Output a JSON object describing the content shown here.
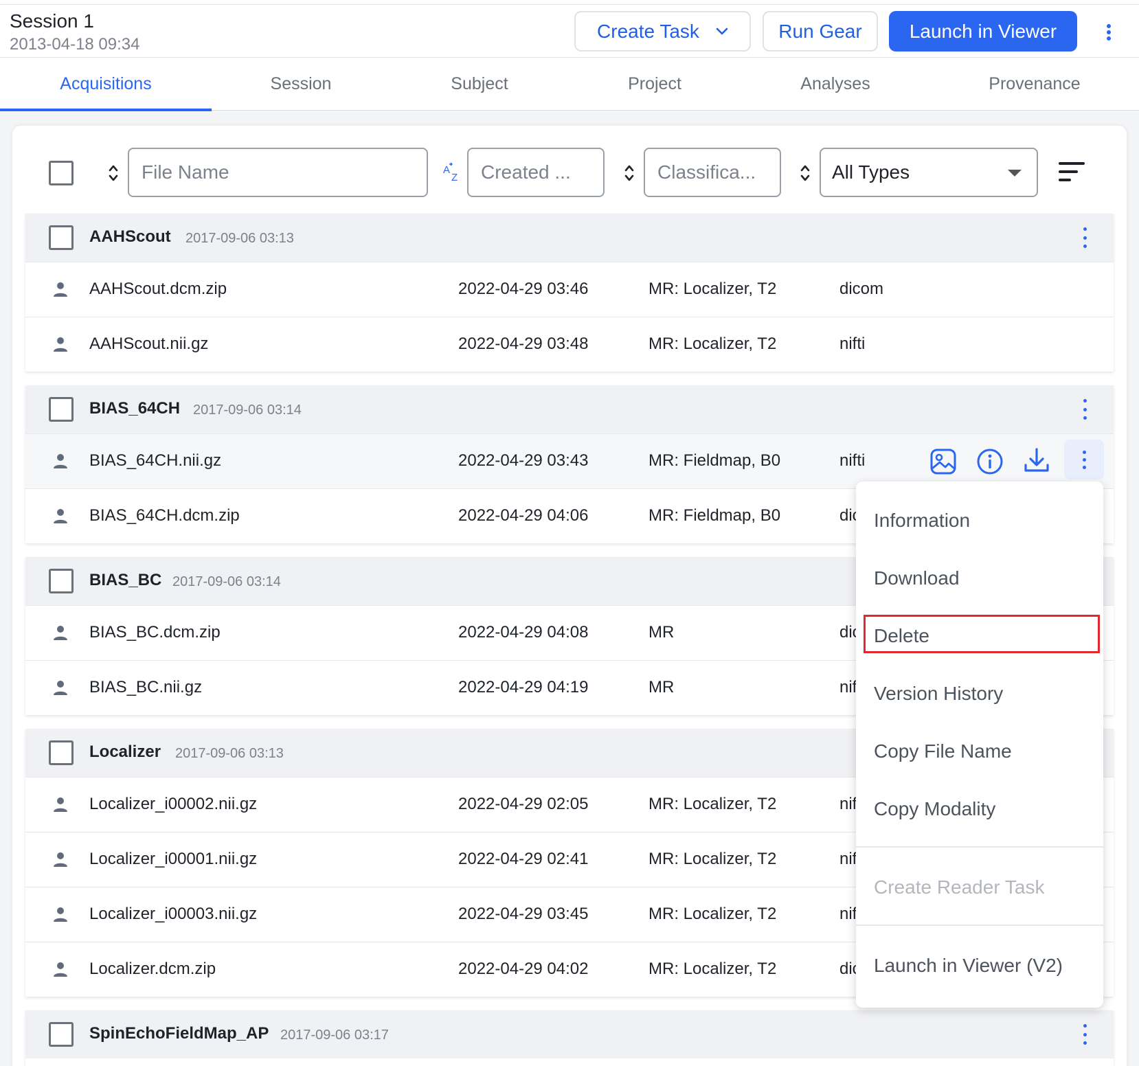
{
  "header": {
    "session_title": "Session 1",
    "session_date": "2013-04-18 09:34",
    "create_task_label": "Create Task",
    "run_gear_label": "Run Gear",
    "launch_viewer_label": "Launch in Viewer"
  },
  "tabs": [
    {
      "label": "Acquisitions",
      "active": true
    },
    {
      "label": "Session"
    },
    {
      "label": "Subject"
    },
    {
      "label": "Project"
    },
    {
      "label": "Analyses"
    },
    {
      "label": "Provenance"
    }
  ],
  "filters": {
    "file_name_placeholder": "File Name",
    "created_placeholder": "Created ...",
    "classification_placeholder": "Classifica...",
    "type_selected": "All Types"
  },
  "groups": [
    {
      "name": "AAHScout",
      "date": "2017-09-06 03:13",
      "rows": [
        {
          "file": "AAHScout.dcm.zip",
          "created": "2022-04-29 03:46",
          "classification": "MR: Localizer, T2",
          "type": "dicom"
        },
        {
          "file": "AAHScout.nii.gz",
          "created": "2022-04-29 03:48",
          "classification": "MR: Localizer, T2",
          "type": "nifti"
        }
      ]
    },
    {
      "name": "BIAS_64CH",
      "date": "2017-09-06 03:14",
      "rows": [
        {
          "file": "BIAS_64CH.nii.gz",
          "created": "2022-04-29 03:43",
          "classification": "MR: Fieldmap, B0",
          "type": "nifti"
        },
        {
          "file": "BIAS_64CH.dcm.zip",
          "created": "2022-04-29 04:06",
          "classification": "MR: Fieldmap, B0",
          "type": "dicom"
        }
      ]
    },
    {
      "name": "BIAS_BC",
      "date": "2017-09-06 03:14",
      "rows": [
        {
          "file": "BIAS_BC.dcm.zip",
          "created": "2022-04-29 04:08",
          "classification": "MR",
          "type": "dicom"
        },
        {
          "file": "BIAS_BC.nii.gz",
          "created": "2022-04-29 04:19",
          "classification": "MR",
          "type": "nifti"
        }
      ]
    },
    {
      "name": "Localizer",
      "date": "2017-09-06 03:13",
      "rows": [
        {
          "file": "Localizer_i00002.nii.gz",
          "created": "2022-04-29 02:05",
          "classification": "MR: Localizer, T2",
          "type": "nifti"
        },
        {
          "file": "Localizer_i00001.nii.gz",
          "created": "2022-04-29 02:41",
          "classification": "MR: Localizer, T2",
          "type": "nifti"
        },
        {
          "file": "Localizer_i00003.nii.gz",
          "created": "2022-04-29 03:45",
          "classification": "MR: Localizer, T2",
          "type": "nifti"
        },
        {
          "file": "Localizer.dcm.zip",
          "created": "2022-04-29 04:02",
          "classification": "MR: Localizer, T2",
          "type": "dicom"
        }
      ]
    },
    {
      "name": "SpinEchoFieldMap_AP",
      "date": "2017-09-06 03:17",
      "rows": []
    }
  ],
  "menu": {
    "items": [
      {
        "label": "Information"
      },
      {
        "label": "Download"
      },
      {
        "label": "Delete",
        "highlighted": true
      },
      {
        "label": "Version History"
      },
      {
        "label": "Copy File Name"
      },
      {
        "label": "Copy Modality"
      },
      {
        "label": "Create Reader Task",
        "disabled": true
      },
      {
        "label": "Launch in Viewer (V2)"
      }
    ]
  },
  "colors": {
    "accent": "#2b66f0",
    "highlight_border": "#e0282e"
  }
}
